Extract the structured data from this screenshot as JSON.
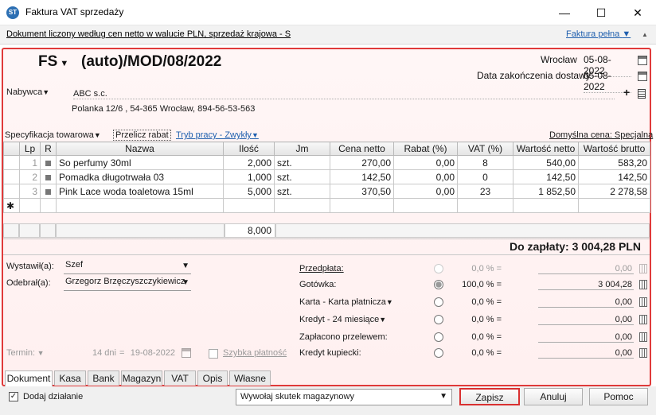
{
  "window": {
    "title": "Faktura VAT sprzedaży",
    "icon_label": "ST",
    "controls": [
      "minimize-icon",
      "maximize-icon",
      "close-icon"
    ]
  },
  "infobar": {
    "text": "Dokument liczony według cen netto w walucie PLN, sprzedaż krajowa - S",
    "faktura_pelna": "Faktura pełna"
  },
  "header": {
    "doc_type": "FS",
    "doc_number": "(auto)/MOD/08/2022",
    "place": "Wrocław",
    "issue_date": "05-08-2022",
    "delivery_label": "Data zakończenia dostawy",
    "delivery_date": "05-08-2022"
  },
  "buyer": {
    "label": "Nabywca",
    "name": "ABC s.c.",
    "address": "Polanka  12/6 , 54-365 Wrocław, 894-56-53-563"
  },
  "toolbar": {
    "specyfikacja": "Specyfikacja towarowa",
    "przelicz": "Przelicz rabat",
    "tryb": "Tryb pracy - Zwykły",
    "domyslna": "Domyślna cena: Specjalna"
  },
  "table": {
    "columns": [
      "Lp",
      "R",
      "Nazwa",
      "Ilość",
      "Jm",
      "Cena netto",
      "Rabat (%)",
      "VAT (%)",
      "Wartość netto",
      "Wartość brutto"
    ],
    "rows": [
      {
        "lp": "1",
        "nazwa": "So perfumy 30ml",
        "ilosc": "2,000",
        "jm": "szt.",
        "cena": "270,00",
        "rabat": "0,00",
        "vat": "8",
        "netto": "540,00",
        "brutto": "583,20"
      },
      {
        "lp": "2",
        "nazwa": "Pomadka długotrwała 03",
        "ilosc": "1,000",
        "jm": "szt.",
        "cena": "142,50",
        "rabat": "0,00",
        "vat": "0",
        "netto": "142,50",
        "brutto": "142,50"
      },
      {
        "lp": "3",
        "nazwa": "Pink Lace woda toaletowa 15ml",
        "ilosc": "5,000",
        "jm": "szt.",
        "cena": "370,50",
        "rabat": "0,00",
        "vat": "23",
        "netto": "1 852,50",
        "brutto": "2 278,58"
      }
    ],
    "new_row_marker": "✱",
    "sum_ilosc": "8,000"
  },
  "total": "Do zapłaty: 3 004,28 PLN",
  "people": {
    "wystawil_label": "Wystawił(a):",
    "wystawil_value": "Szef",
    "odebral_label": "Odebrał(a):",
    "odebral_value": "Grzegorz Brzęczyszczykiewicz"
  },
  "termin": {
    "label": "Termin:",
    "days": "14 dni",
    "sep": "=",
    "date": "19-08-2022",
    "szybka": "Szybka płatność"
  },
  "payments": [
    {
      "label": "Przedpłata:",
      "pct": "0,0 % =",
      "amount": "0,00",
      "state": "disabled",
      "underline": true
    },
    {
      "label": "Gotówka:",
      "pct": "100,0 % =",
      "amount": "3 004,28",
      "state": "selected",
      "underline": false
    },
    {
      "label": "Karta - Karta płatnicza",
      "pct": "0,0 % =",
      "amount": "0,00",
      "state": "normal",
      "underline": false
    },
    {
      "label": "Kredyt - 24 miesiące",
      "pct": "0,0 % =",
      "amount": "0,00",
      "state": "normal",
      "underline": false
    },
    {
      "label": "Zapłacono przelewem:",
      "pct": "0,0 % =",
      "amount": "0,00",
      "state": "normal",
      "underline": false
    },
    {
      "label": "Kredyt kupiecki:",
      "pct": "0,0 % =",
      "amount": "0,00",
      "state": "normal",
      "underline": false
    }
  ],
  "tabs": [
    "Dokument",
    "Kasa",
    "Bank",
    "Magazyn",
    "VAT",
    "Opis",
    "Własne"
  ],
  "bottom": {
    "dodaj": "Dodaj działanie",
    "dodaj_check": "✓",
    "select_value": "Wywołaj skutek magazynowy",
    "zapisz": "Zapisz",
    "anuluj": "Anuluj",
    "pomoc": "Pomoc"
  },
  "colors": {
    "accent": "#1f5fae",
    "highlight": "#e03a3a"
  }
}
